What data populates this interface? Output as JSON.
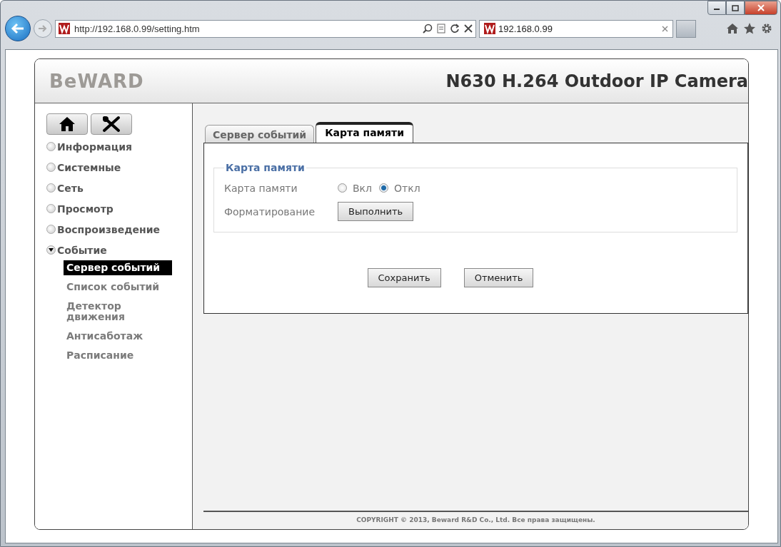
{
  "browser": {
    "address": "http://192.168.0.99/setting.htm",
    "tab_title": "192.168.0.99"
  },
  "header": {
    "logo": "BeWARD",
    "title": "N630 H.264 Outdoor IP Camera"
  },
  "menu": [
    {
      "label": "Информация",
      "expanded": false
    },
    {
      "label": "Системные",
      "expanded": false
    },
    {
      "label": "Сеть",
      "expanded": false
    },
    {
      "label": "Просмотр",
      "expanded": false
    },
    {
      "label": "Воспроизведение",
      "expanded": false
    },
    {
      "label": "Событие",
      "expanded": true,
      "children": [
        {
          "label": "Сервер событий",
          "selected": true
        },
        {
          "label": "Список событий",
          "selected": false
        },
        {
          "label": "Детектор движения",
          "selected": false
        },
        {
          "label": "Антисаботаж",
          "selected": false
        },
        {
          "label": "Расписание",
          "selected": false
        }
      ]
    }
  ],
  "tabs": [
    {
      "label": "Сервер событий",
      "selected": false
    },
    {
      "label": "Карта памяти",
      "selected": true
    }
  ],
  "fieldset": {
    "legend": "Карта памяти",
    "rows": [
      {
        "kind": "radio",
        "label": "Карта памяти",
        "options": [
          {
            "label": "Вкл",
            "selected": false
          },
          {
            "label": "Откл",
            "selected": true
          }
        ]
      },
      {
        "kind": "button",
        "label": "Форматирование",
        "button": "Выполнить"
      }
    ]
  },
  "actions": [
    "Сохранить",
    "Отменить"
  ],
  "footer": "COPYRIGHT © 2013, Beward R&D Co., Ltd. Все права защищены."
}
